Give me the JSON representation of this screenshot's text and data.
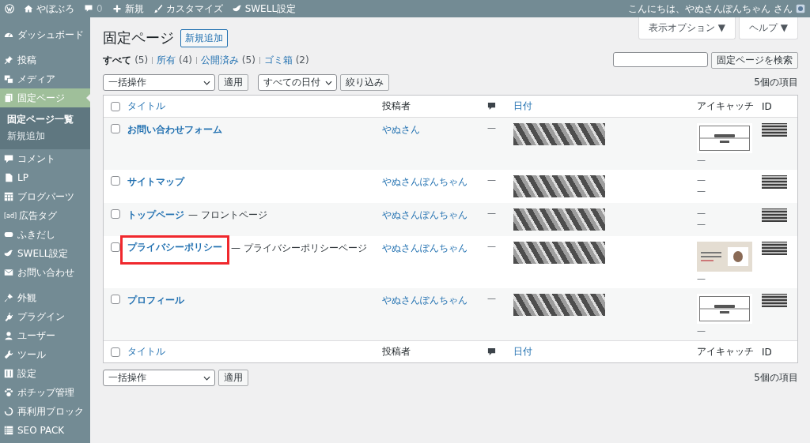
{
  "admin_bar": {
    "site_name": "やぼぶろ",
    "comment_count": "0",
    "new_label": "新規",
    "customize_label": "カスタマイズ",
    "swell_label": "SWELL設定",
    "greeting": "こんにちは、やぬさんぽんちゃん さん"
  },
  "sidebar": {
    "groups": [
      [
        {
          "label": "ダッシュボード",
          "selected": false
        }
      ],
      [
        {
          "label": "投稿",
          "selected": false
        },
        {
          "label": "メディア",
          "selected": false
        },
        {
          "label": "固定ページ",
          "selected": true,
          "children": [
            {
              "label": "固定ページ一覧",
              "selected": true
            },
            {
              "label": "新規追加",
              "selected": false
            }
          ]
        },
        {
          "label": "コメント",
          "selected": false
        },
        {
          "label": "LP",
          "selected": false
        },
        {
          "label": "ブログパーツ",
          "selected": false
        },
        {
          "label": "広告タグ",
          "selected": false,
          "icon_text": "[ad]"
        },
        {
          "label": "ふきだし",
          "selected": false
        },
        {
          "label": "SWELL設定",
          "selected": false
        },
        {
          "label": "お問い合わせ",
          "selected": false
        }
      ],
      [
        {
          "label": "外観",
          "selected": false
        },
        {
          "label": "プラグイン",
          "selected": false
        },
        {
          "label": "ユーザー",
          "selected": false
        },
        {
          "label": "ツール",
          "selected": false
        },
        {
          "label": "設定",
          "selected": false
        },
        {
          "label": "ポチップ管理",
          "selected": false
        },
        {
          "label": "再利用ブロック",
          "selected": false
        },
        {
          "label": "SEO PACK",
          "selected": false
        }
      ]
    ]
  },
  "header": {
    "title": "固定ページ",
    "add_new": "新規追加",
    "screen_options": "表示オプション ▼",
    "help": "ヘルプ ▼"
  },
  "views": [
    {
      "label": "すべて",
      "count": "(5)",
      "selected": true
    },
    {
      "label": "所有",
      "count": "(4)",
      "selected": false
    },
    {
      "label": "公開済み",
      "count": "(5)",
      "selected": false
    },
    {
      "label": "ゴミ箱",
      "count": "(2)",
      "selected": false
    }
  ],
  "search": {
    "button": "固定ページを検索"
  },
  "top_nav": {
    "bulk_action": "一括操作",
    "apply": "適用",
    "date_filter": "すべての日付",
    "filter": "絞り込み",
    "items_count": "5個の項目"
  },
  "table": {
    "select_all_checked": false,
    "columns": [
      {
        "kind": "title",
        "label": "タイトル",
        "sortable": true
      },
      {
        "kind": "author",
        "label": "投稿者",
        "sortable": false
      },
      {
        "kind": "comments"
      },
      {
        "kind": "date",
        "label": "日付",
        "sortable": true
      },
      {
        "kind": "featured",
        "label": "アイキャッチ",
        "sortable": false
      },
      {
        "kind": "id",
        "label": "ID",
        "sortable": false
      }
    ],
    "rows": [
      {
        "title": "お問い合わせフォーム",
        "author": "やぬさん",
        "comments": "—",
        "kind": "banner",
        "checked": false,
        "featured_lines": [
          "—"
        ],
        "highlighted": false
      },
      {
        "title": "サイトマップ",
        "author": "やぬさんぽんちゃん",
        "comments": "—",
        "kind": "plain",
        "checked": false,
        "featured_lines": [
          "—",
          "—"
        ],
        "highlighted": false
      },
      {
        "title": "トップページ",
        "post_state": "— フロントページ",
        "author": "やぬさんぽんちゃん",
        "comments": "—",
        "kind": "plain",
        "checked": false,
        "featured_lines": [
          "—",
          "—"
        ],
        "highlighted": false
      },
      {
        "title": "プライバシーポリシー",
        "post_state": "— プライバシーポリシーページ",
        "author": "やぬさんぽんちゃん",
        "comments": "—",
        "kind": "illustration",
        "checked": false,
        "featured_lines": [
          "—"
        ],
        "highlighted": true
      },
      {
        "title": "プロフィール",
        "author": "やぬさんぽんちゃん",
        "comments": "—",
        "kind": "banner",
        "checked": false,
        "featured_lines": [
          "—"
        ],
        "highlighted": false
      }
    ],
    "footer_select_all_checked": false,
    "footer_columns": [
      {
        "kind": "title",
        "label": "タイトル",
        "sortable": true
      },
      {
        "kind": "author",
        "label": "投稿者",
        "sortable": false
      },
      {
        "kind": "comments"
      },
      {
        "kind": "date",
        "label": "日付",
        "sortable": true
      },
      {
        "kind": "featured",
        "label": "アイキャッチ",
        "sortable": false
      },
      {
        "kind": "id",
        "label": "ID",
        "sortable": false
      }
    ]
  },
  "bottom_nav": {
    "bulk_action": "一括操作",
    "apply": "適用",
    "items_count": "5個の項目"
  }
}
